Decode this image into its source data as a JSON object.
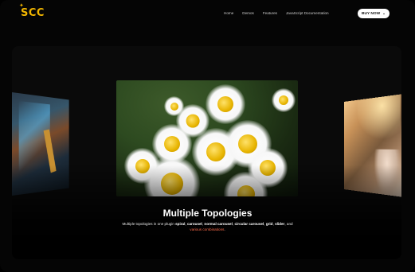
{
  "brand": {
    "logo_text": "SCC"
  },
  "nav": {
    "items": [
      "Home",
      "Demos",
      "Features",
      "JavaScript Documentation"
    ],
    "buy_label": "BUY NOW"
  },
  "hero": {
    "title": "Multiple Topologies",
    "subtitle_prefix": "Multiple topologies in one plugin",
    "subtitle_items": [
      "spiral",
      "carousel",
      "normal carousel",
      "circular carousel",
      "grid",
      "slider"
    ],
    "subtitle_and": "and",
    "subtitle_accent": "various combinations",
    "subtitle_end": "."
  },
  "colors": {
    "brand": "#f2b600",
    "accent": "#ff6b4a"
  },
  "icons": {
    "buy_chevron": "chevron-down-icon",
    "logo_spark": "spark-icon"
  }
}
